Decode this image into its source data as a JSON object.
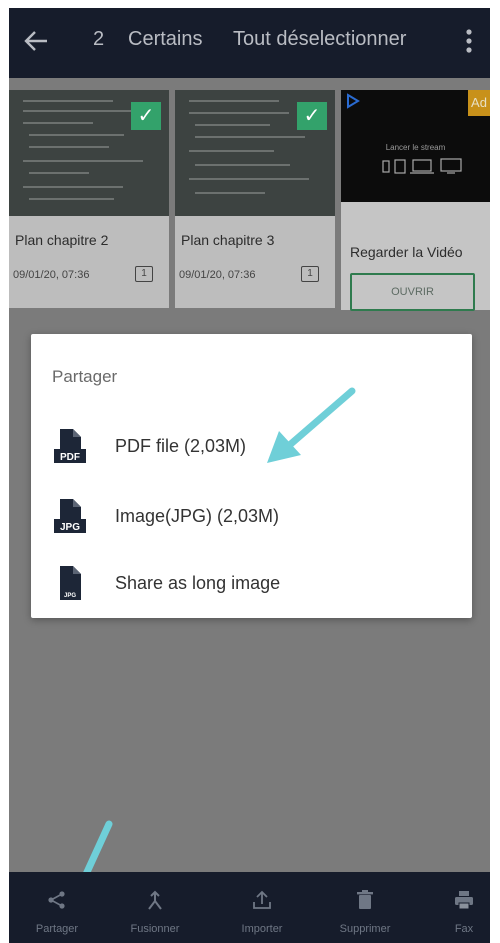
{
  "topbar": {
    "selected_count": "2",
    "certains": "Certains",
    "deselect_all": "Tout déselectionner"
  },
  "documents": [
    {
      "title": "Plan chapitre 2",
      "date": "09/01/20, 07:36",
      "pages": "1",
      "selected": true
    },
    {
      "title": "Plan chapitre 3",
      "date": "09/01/20, 07:36",
      "pages": "1",
      "selected": true
    }
  ],
  "ad": {
    "badge": "Ad",
    "image_text": "Lancer le stream",
    "title": "Regarder la Vidéo",
    "button": "OUVRIR"
  },
  "share_dialog": {
    "title": "Partager",
    "options": [
      {
        "label": "PDF file (2,03M)",
        "icon_text": "PDF",
        "icon": "pdf-file-icon"
      },
      {
        "label": "Image(JPG) (2,03M)",
        "icon_text": "JPG",
        "icon": "jpg-file-icon"
      },
      {
        "label": "Share as long image",
        "icon_text": "JPG",
        "icon": "long-image-icon"
      }
    ]
  },
  "bottom_bar": [
    {
      "label": "Partager",
      "icon": "share-icon"
    },
    {
      "label": "Fusionner",
      "icon": "merge-icon"
    },
    {
      "label": "Importer",
      "icon": "import-icon"
    },
    {
      "label": "Supprimer",
      "icon": "trash-icon"
    },
    {
      "label": "Fax",
      "icon": "printer-icon"
    }
  ],
  "colors": {
    "topbar_bg": "#161c2b",
    "check_green": "#33a26b",
    "arrow": "#6fcfd8",
    "ad_badge": "#c8911a",
    "dim_overlay": "#7b7b7b"
  }
}
